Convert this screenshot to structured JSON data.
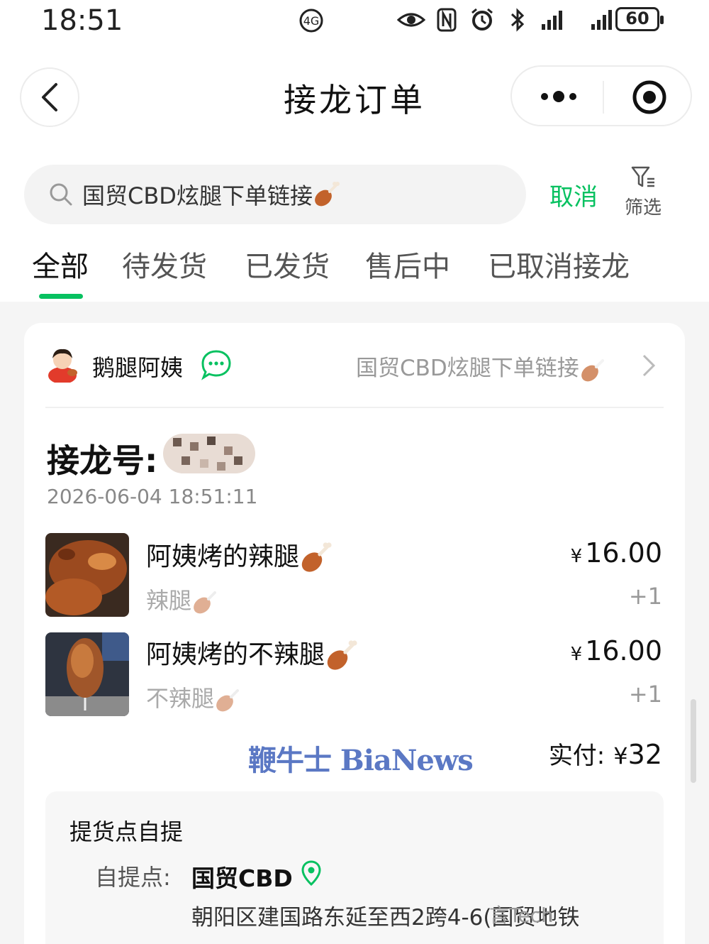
{
  "status_bar": {
    "time": "18:51",
    "battery": "60",
    "icons": [
      "eye-icon",
      "nfc-icon",
      "alarm-icon",
      "bluetooth-icon",
      "signal-icon",
      "signal-icon"
    ]
  },
  "nav": {
    "title": "接龙订单",
    "back_icon": "back-arrow-icon",
    "more_icon": "more-dots-icon",
    "close_icon": "target-icon"
  },
  "search": {
    "query": "国贸CBD炫腿下单链接",
    "cancel_label": "取消",
    "filter_label": "筛选"
  },
  "tabs": [
    {
      "label": "全部",
      "active": true
    },
    {
      "label": "待发货",
      "active": false
    },
    {
      "label": "已发货",
      "active": false
    },
    {
      "label": "售后中",
      "active": false
    },
    {
      "label": "已取消接龙",
      "active": false
    }
  ],
  "order": {
    "shop_name": "鹅腿阿姨",
    "link_text": "国贸CBD炫腿下单链接",
    "order_label": "接龙号:",
    "time": "2026-06-04 18:51:11",
    "items": [
      {
        "name": "阿姨烤的辣腿",
        "spec": "辣腿",
        "currency": "¥",
        "price": "16.00",
        "qty": "+1"
      },
      {
        "name": "阿姨烤的不辣腿",
        "spec": "不辣腿",
        "currency": "¥",
        "price": "16.00",
        "qty": "+1"
      }
    ],
    "paid_label": "实付:",
    "paid_currency": "¥",
    "paid_amount": "32",
    "pickup": {
      "title": "提货点自提",
      "point_label": "自提点:",
      "point_name": "国贸CBD",
      "address": "朝阳区建国路东延至西2跨4-6(国贸地铁"
    }
  },
  "watermark": "鞭牛士 BiaNews",
  "corner_mark": "言Tech",
  "colors": {
    "accent": "#07c160",
    "watermark": "#5b78c4"
  }
}
